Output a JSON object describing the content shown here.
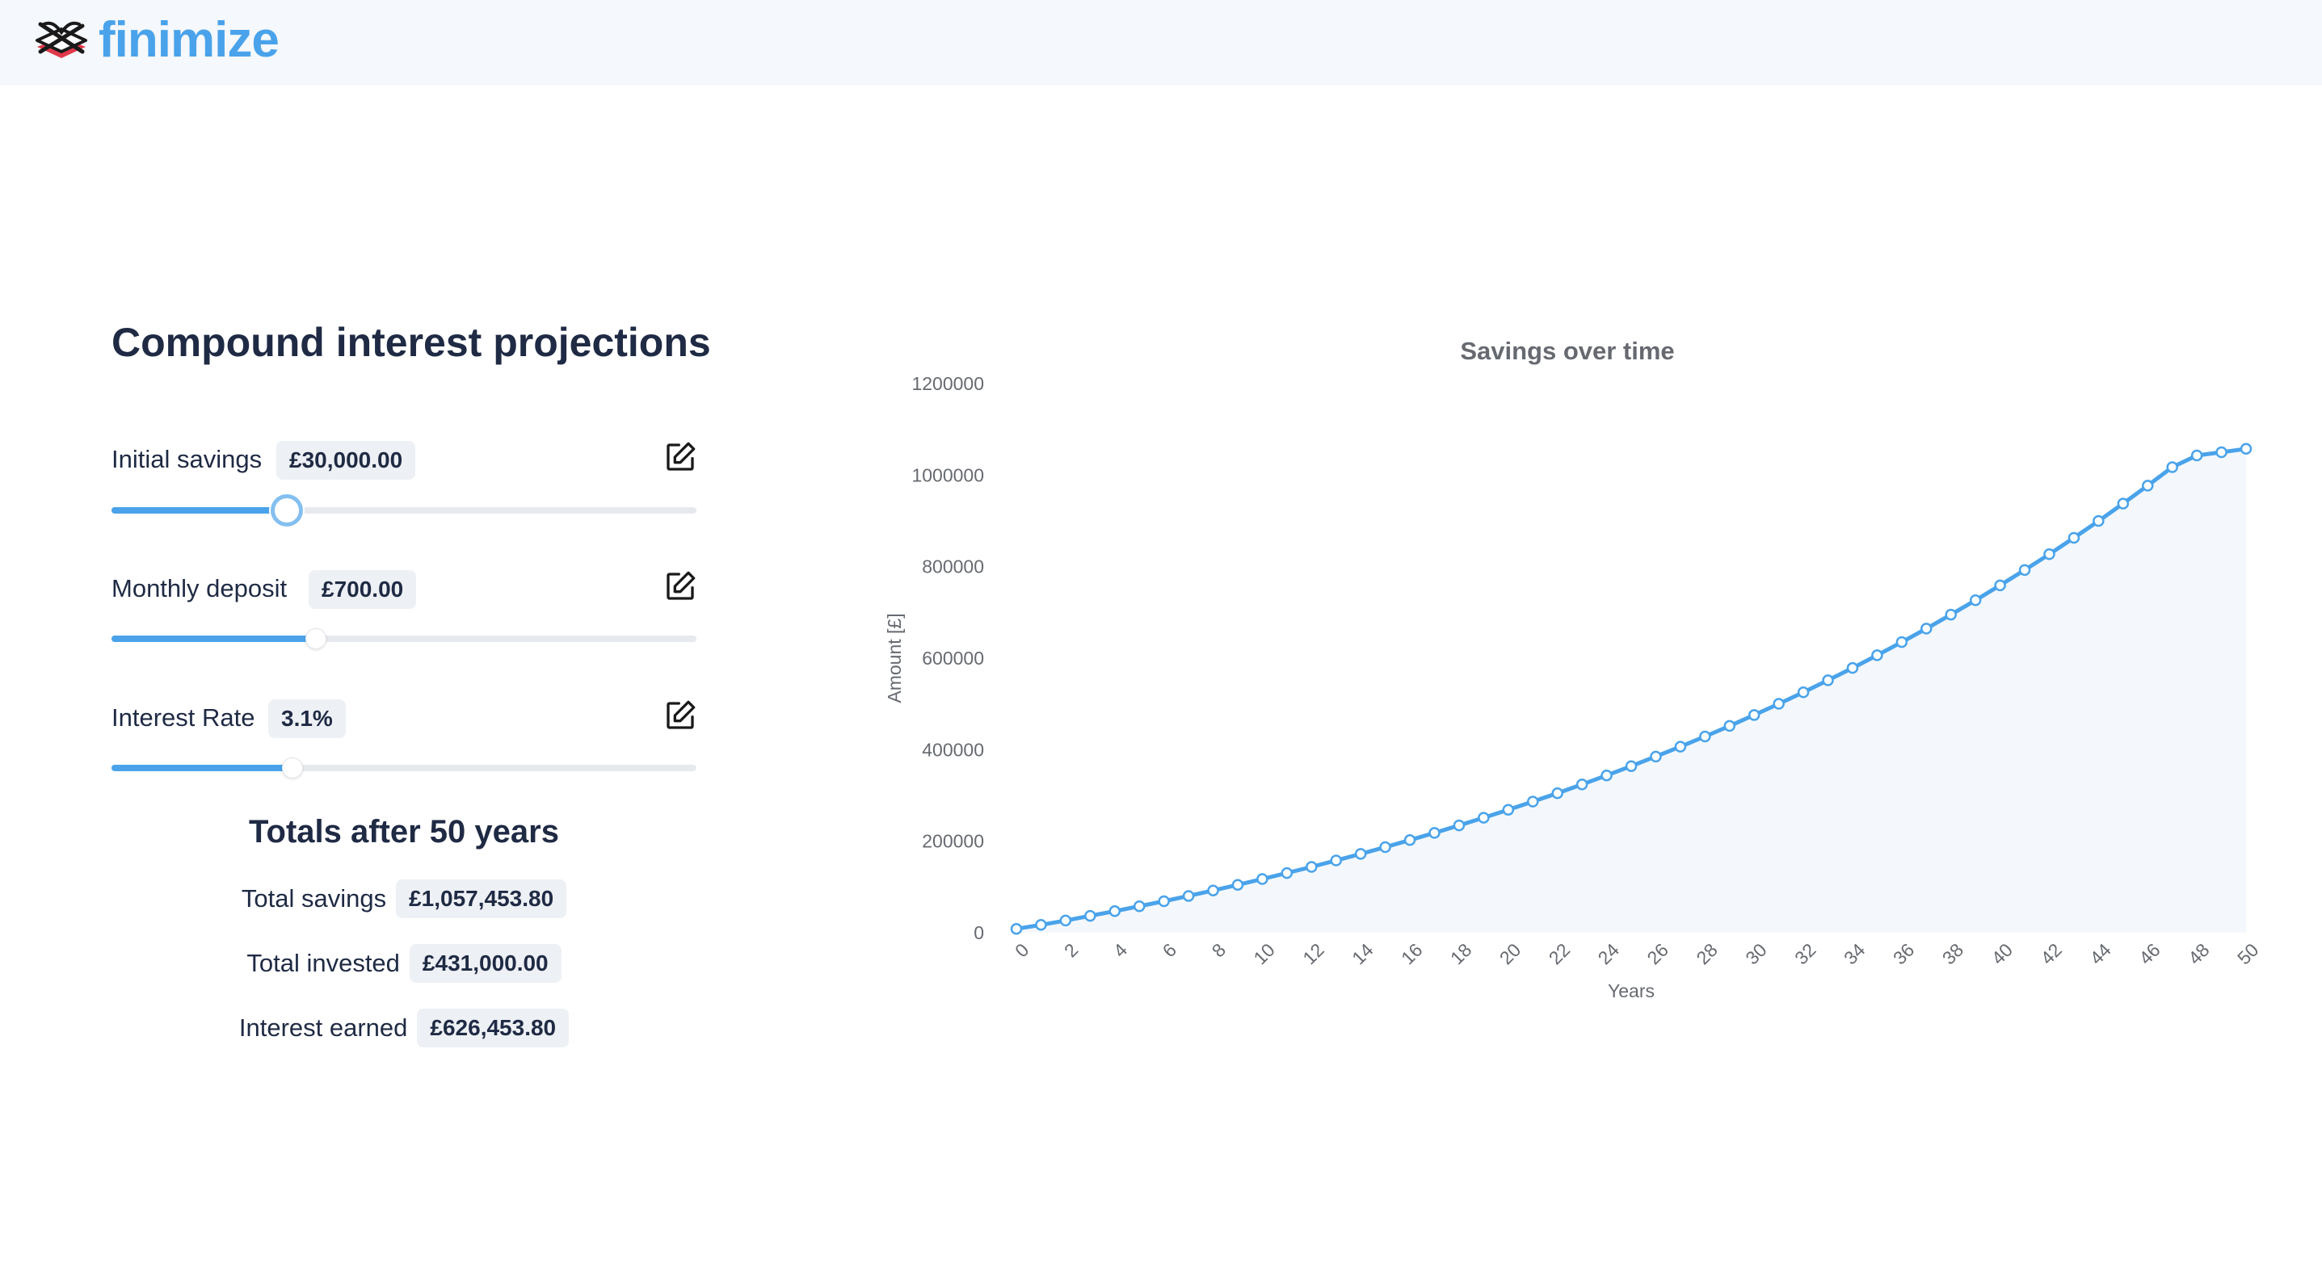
{
  "brand": {
    "name": "finimize",
    "icon": "finimize-logo-icon",
    "color": "#4aa3ea"
  },
  "calculator": {
    "title": "Compound interest projections",
    "controls": [
      {
        "label": "Initial savings",
        "value": "£30,000.00",
        "edit_icon": "edit-icon",
        "slider_fraction": 0.3
      },
      {
        "label": "Monthly deposit",
        "value": "£700.00",
        "edit_icon": "edit-icon",
        "slider_fraction": 0.35
      },
      {
        "label": "Interest Rate",
        "value": "3.1%",
        "edit_icon": "edit-icon",
        "slider_fraction": 0.31
      }
    ],
    "totals": {
      "title": "Totals after 50 years",
      "rows": [
        {
          "label": "Total savings",
          "value": "£1,057,453.80"
        },
        {
          "label": "Total invested",
          "value": "£431,000.00"
        },
        {
          "label": "Interest earned",
          "value": "£626,453.80"
        }
      ]
    }
  },
  "colors": {
    "accent": "#4aa3ea",
    "track": "#e6e9ee",
    "pill": "#edf0f4",
    "text": "#1f2a44",
    "area_fill": "#f4f8fd"
  },
  "chart_data": {
    "type": "line",
    "title": "Savings over time",
    "xlabel": "Years",
    "ylabel": "Amount [£]",
    "xlim": [
      0,
      50
    ],
    "ylim": [
      0,
      1200000
    ],
    "x_ticks": [
      0,
      2,
      4,
      6,
      8,
      10,
      12,
      14,
      16,
      18,
      20,
      22,
      24,
      26,
      28,
      30,
      32,
      34,
      36,
      38,
      40,
      42,
      44,
      46,
      48,
      50
    ],
    "y_ticks": [
      0,
      200000,
      400000,
      600000,
      800000,
      1000000,
      1200000
    ],
    "grid": false,
    "legend": "none",
    "area_fill": true,
    "series": [
      {
        "x": [
          0,
          1,
          2,
          3,
          4,
          5,
          6,
          7,
          8,
          9,
          10,
          11,
          12,
          13,
          14,
          15,
          16,
          17,
          18,
          19,
          20,
          21,
          22,
          23,
          24,
          25,
          26,
          27,
          28,
          29,
          30,
          31,
          32,
          33,
          34,
          35,
          36,
          37,
          38,
          39,
          40,
          41,
          42,
          43,
          44,
          45,
          46,
          47,
          48,
          49,
          50
        ],
        "values": [
          8400,
          17200,
          26700,
          36800,
          47100,
          57800,
          68900,
          80400,
          92300,
          104600,
          117300,
          130400,
          143900,
          157900,
          172300,
          187100,
          202400,
          218200,
          234500,
          251300,
          268600,
          286500,
          304900,
          324000,
          343700,
          364000,
          385000,
          406600,
          428900,
          451900,
          475700,
          500200,
          525500,
          551600,
          578500,
          606300,
          635000,
          664600,
          695100,
          726600,
          759100,
          792600,
          827200,
          862900,
          899700,
          937700,
          976900,
          1017300,
          1043000,
          1050000,
          1057454
        ]
      }
    ]
  }
}
